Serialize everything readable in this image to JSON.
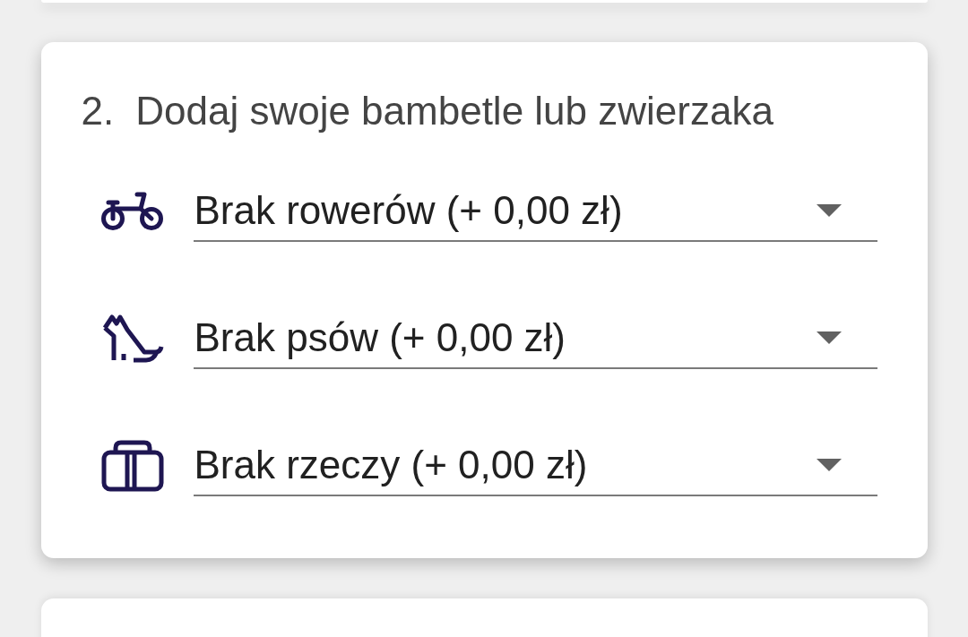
{
  "card": {
    "step_number": "2.",
    "title": "Dodaj swoje bambetle lub zwierzaka",
    "selects": [
      {
        "kind": "bicycle",
        "value": "Brak rowerów (+ 0,00 zł)"
      },
      {
        "kind": "dog",
        "value": "Brak psów (+ 0,00 zł)"
      },
      {
        "kind": "luggage",
        "value": "Brak rzeczy (+ 0,00 zł)"
      }
    ]
  }
}
